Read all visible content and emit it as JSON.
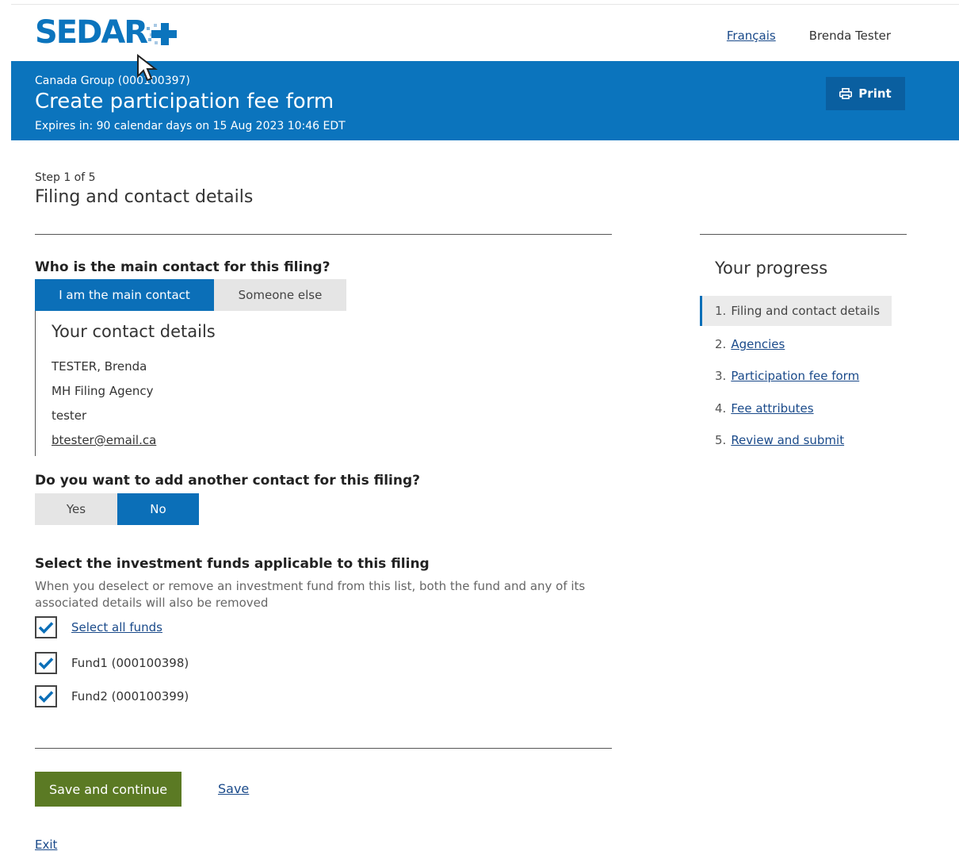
{
  "header": {
    "logo_text": "SEDAR",
    "language_link": "Français",
    "user_name": "Brenda Tester"
  },
  "banner": {
    "group": "Canada Group (000100397)",
    "title": "Create participation fee form",
    "expires": "Expires in: 90 calendar days on 15 Aug 2023 10:46 EDT",
    "print_label": "Print"
  },
  "step": {
    "counter": "Step 1 of 5",
    "title": "Filing and contact details"
  },
  "main_contact": {
    "question": "Who is the main contact for this filing?",
    "options": [
      "I am the main contact",
      "Someone else"
    ],
    "selected": "I am the main contact"
  },
  "contact_details": {
    "title": "Your contact details",
    "name": "TESTER, Brenda",
    "agency": "MH Filing Agency",
    "username": "tester",
    "email": "btester@email.ca"
  },
  "another_contact": {
    "question": "Do you want to add another contact for this filing?",
    "options": [
      "Yes",
      "No"
    ],
    "selected": "No"
  },
  "funds": {
    "question": "Select the investment funds applicable to this filing",
    "hint": "When you deselect or remove an investment fund from this list, both the fund and any of its associated details will also be removed",
    "select_all_label": "Select all funds",
    "items": [
      {
        "label": "Fund1 (000100398)",
        "checked": true
      },
      {
        "label": "Fund2 (000100399)",
        "checked": true
      }
    ]
  },
  "actions": {
    "save_continue": "Save and continue",
    "save": "Save",
    "exit": "Exit"
  },
  "progress": {
    "title": "Your progress",
    "items": [
      {
        "num": "1.",
        "label": "Filing and contact details",
        "current": true
      },
      {
        "num": "2.",
        "label": "Agencies",
        "current": false
      },
      {
        "num": "3.",
        "label": "Participation fee form",
        "current": false
      },
      {
        "num": "4.",
        "label": "Fee attributes",
        "current": false
      },
      {
        "num": "5.",
        "label": "Review and submit",
        "current": false
      }
    ]
  },
  "colors": {
    "brand_blue": "#0b74bd",
    "selected_blue": "#0b6fb8",
    "primary_green": "#5b7a24"
  }
}
